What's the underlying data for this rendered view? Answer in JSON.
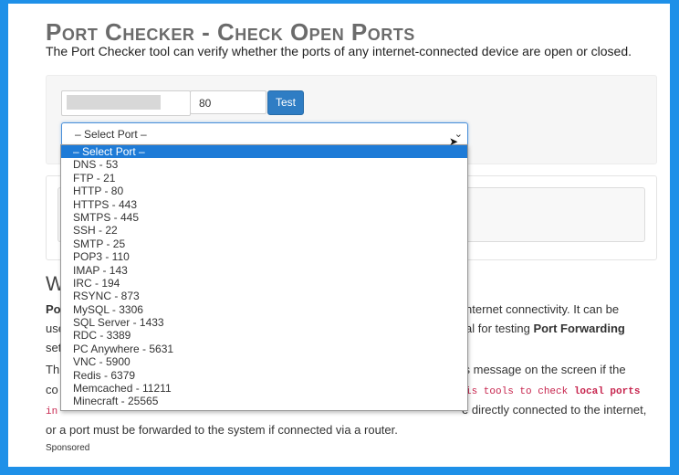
{
  "page": {
    "title": "Port Checker - Check Open Ports",
    "subtitle": "The Port Checker tool can verify whether the ports of any internet-connected device are open or closed."
  },
  "form": {
    "port_value": "80",
    "test_label": "Test",
    "select_value": "– Select Port –"
  },
  "dropdown": {
    "options": [
      "– Select Port –",
      "DNS - 53",
      "FTP - 21",
      "HTTP - 80",
      "HTTPS - 443",
      "SMTPS - 445",
      "SSH - 22",
      "SMTP - 25",
      "POP3 - 110",
      "IMAP - 143",
      "IRC - 194",
      "RSYNC - 873",
      "MySQL - 3306",
      "SQL Server - 1433",
      "RDC - 3389",
      "PC Anywhere - 5631",
      "VNC - 5900",
      "Redis - 6379",
      "Memcached - 11211",
      "Minecraft - 25565"
    ],
    "selected_index": 0
  },
  "content": {
    "heading_fragment": "W",
    "p1_line1_left": "Po",
    "p1_line1_right": "nternet connectivity. It can be",
    "p1_line2_left": "use",
    "p1_line2_right_pre": "al for testing ",
    "p1_line2_right_bold": "Port Forwarding",
    "p1_line3_left": "set",
    "p2_line1_left": "Th",
    "p2_line1_right": "ss message on the screen if the",
    "p2_line2_left": "co",
    "p2_line2_code_pre": "is tools to check ",
    "p2_line2_code_bold": "local ports",
    "p2_line3_code_left": "in",
    "p2_line3_right": "e directly connected to the internet,",
    "p2_line4": "or a port must be forwarded to the system if connected via a router."
  },
  "footer": {
    "sponsored": "Sponsored"
  },
  "colors": {
    "outer_border": "#1e90e8",
    "button": "#2f7dc4",
    "dropdown_highlight": "#1e7bd7",
    "code_text": "#c7254e"
  }
}
